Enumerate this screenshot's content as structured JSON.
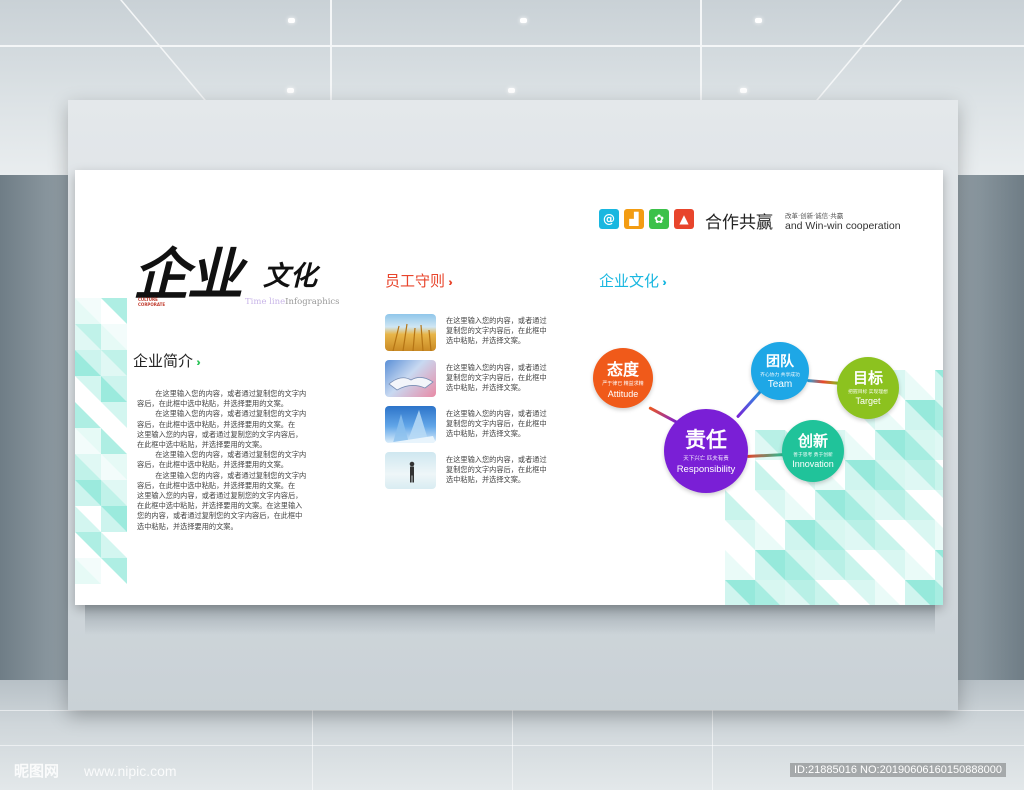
{
  "header": {
    "slogan": "合作共赢",
    "slogan_small": "改革·创新·诚信·共赢",
    "slogan_en": "and Win-win  cooperation",
    "icons": [
      "at-icon",
      "chart-icon",
      "gear-icon",
      "person-icon"
    ],
    "icon_glyphs": [
      "@",
      "▟",
      "✿",
      "▲"
    ]
  },
  "title": {
    "calli_big": "企业",
    "calli_small": "文化",
    "culture_tag_1": "CULTURE",
    "culture_tag_2": "CORPORATE",
    "timeline_a": "Time line",
    "timeline_b": "Infographics"
  },
  "intro": {
    "title": "企业简介",
    "arrows": "›››",
    "lines": [
      "        在这里输入您的内容，或者通过复制您的文字内",
      "容后，在此框中选中粘贴，并选择要用的文案。",
      "        在这里输入您的内容，或者通过复制您的文字内",
      "容后，在此框中选中粘贴，并选择要用的文案。在",
      "这里输入您的内容，或者通过复制您的文字内容后，",
      "在此框中选中粘贴，并选择要用的文案。",
      "        在这里输入您的内容，或者通过复制您的文字内",
      "容后，在此框中选中粘贴，并选择要用的文案。",
      "        在这里输入您的内容，或者通过复制您的文字内",
      "容后，在此框中选中粘贴，并选择要用的文案。在",
      "这里输入您的内容，或者通过复制您的文字内容后，",
      "在此框中选中粘贴，并选择要用的文案。在这里输入",
      "您的内容，或者通过复制您的文字内容后，在此框中",
      "选中粘贴，并选择要用的文案。"
    ]
  },
  "rules": {
    "title": "员工守则",
    "arrows": "›››",
    "items": [
      {
        "thumb": "wheat-photo",
        "text": "在这里输入您的内容，或者通过\n复制您的文字内容后，在此框中\n选中粘贴，并选择文案。"
      },
      {
        "thumb": "handshake-photo",
        "text": "在这里输入您的内容，或者通过\n复制您的文字内容后，在此框中\n选中粘贴，并选择文案。"
      },
      {
        "thumb": "building-photo",
        "text": "在这里输入您的内容，或者通过\n复制您的文字内容后，在此框中\n选中粘贴，并选择文案。"
      },
      {
        "thumb": "businessman-photo",
        "text": "在这里输入您的内容，或者通过\n复制您的文字内容后，在此框中\n选中粘贴，并选择文案。"
      }
    ]
  },
  "culture": {
    "title": "企业文化",
    "arrows": "›››",
    "nodes": [
      {
        "zh": "态度",
        "sub": "严于律已  精益求精",
        "en": "Attitude",
        "color": "#f05a1a"
      },
      {
        "zh": "责任",
        "sub": "天下兴亡  匹夫有责",
        "en": "Responsibility",
        "color": "#7a1fd6"
      },
      {
        "zh": "团队",
        "sub": "齐心协力  共享成功",
        "en": "Team",
        "color": "#1ea7e6"
      },
      {
        "zh": "目标",
        "sub": "把握目标  实现理想",
        "en": "Target",
        "color": "#8cc21f"
      },
      {
        "zh": "创新",
        "sub": "善于思考  勇于创新",
        "en": "Innovation",
        "color": "#20c39a"
      }
    ]
  },
  "colors": {
    "accent_teal": "#2ed3b7",
    "arrow_green": "#2fc45a",
    "arrow_red": "#e8452c",
    "arrow_cyan": "#19b7e0"
  },
  "watermark": {
    "logo": "昵图网",
    "site": "www.nipic.com",
    "id": "ID:21885016 NO:20190606160150888000"
  }
}
